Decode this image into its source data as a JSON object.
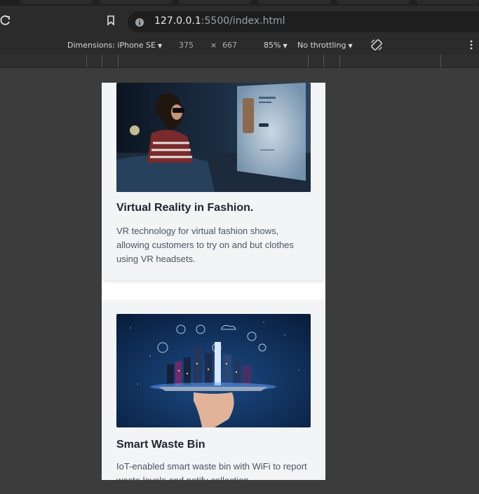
{
  "browser": {
    "url_host": "127.0.0.1",
    "url_rest": ":5500/index.html"
  },
  "devtools": {
    "dimensions_label": "Dimensions: iPhone SE",
    "width": "375",
    "times": "×",
    "height": "667",
    "zoom": "85%",
    "throttling": "No throttling"
  },
  "icons": [
    "reload-icon",
    "bookmark-icon",
    "site-info-icon",
    "rotate-icon",
    "kebab-menu-icon"
  ],
  "cards": [
    {
      "title": "Virtual Reality in Fashion.",
      "description": "VR technology for virtual fashion shows, allowing customers to try on and but clothes using VR headsets."
    },
    {
      "title": "Smart Waste Bin",
      "description": "IoT-enabled smart waste bin with WiFi to report waste levels and notify collection"
    }
  ],
  "colors": {
    "page_bg": "#3c3c3c",
    "card_bg": "#f3f4f6",
    "title": "#1f2430",
    "text": "#4b5563"
  }
}
